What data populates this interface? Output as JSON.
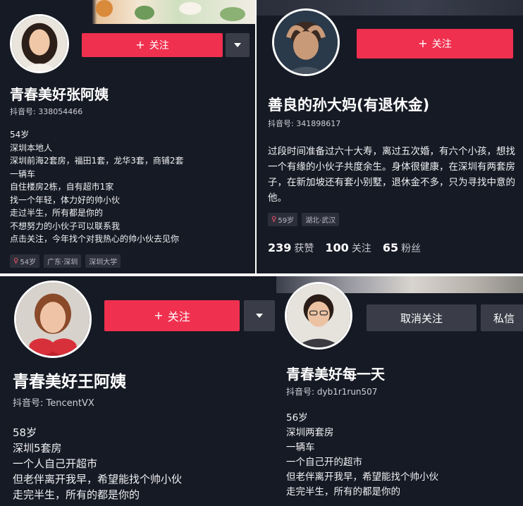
{
  "colors": {
    "background": "#161a24",
    "accent": "#f0304f",
    "secondary_button": "#3a3d47",
    "tag_bg": "#2c2f3a"
  },
  "profiles": [
    {
      "follow_label": "关注",
      "follow_icon": "plus-icon",
      "name": "青春美好张阿姨",
      "douyin_id": "抖音号: 338054466",
      "bio": [
        "54岁",
        "深圳本地人",
        "深圳前海2套房，福田1套，龙华3套，商铺2套",
        "一辆车",
        "自住楼房2栋，自有超市1家",
        "找一个年轻，体力好的帅小伙",
        "走过半生，所有都是你的",
        "不想努力的小伙子可以联系我",
        "点击关注，今年找个对我热心的帅小伙去见你"
      ],
      "tags": [
        "54岁",
        "广东·深圳",
        "深圳大学"
      ]
    },
    {
      "follow_label": "关注",
      "follow_icon": "plus-icon",
      "name": "善良的孙大妈(有退休金)",
      "douyin_id": "抖音号: 341898617",
      "bio_paragraph": "过段时间准备过六十大寿，离过五次婚，有六个小孩，想找一个有缘的小伙子共度余生。身体很健康，在深圳有两套房子，在新加坡还有套小别墅，退休金不多，只为寻找中意的他。",
      "tags": [
        "59岁",
        "湖北·武汉"
      ],
      "stats": [
        {
          "value": "239",
          "label": "获赞"
        },
        {
          "value": "100",
          "label": "关注"
        },
        {
          "value": "65",
          "label": "粉丝"
        }
      ]
    },
    {
      "follow_label": "关注",
      "follow_icon": "plus-icon",
      "name": "青春美好王阿姨",
      "douyin_id": "抖音号: TencentVX",
      "bio": [
        "58岁",
        "深圳5套房",
        "一个人自己开超市",
        "但老伴离开我早，希望能找个帅小伙",
        "走完半生，所有的都是你的"
      ]
    },
    {
      "unfollow_label": "取消关注",
      "message_label": "私信",
      "name": "青春美好每一天",
      "douyin_id": "抖音号: dyb1r1run507",
      "bio": [
        "56岁",
        "深圳两套房",
        "一辆车",
        "一个自己开的超市",
        "但老伴离开我早，希望能找个帅小伙",
        "走完半生，所有的都是你的"
      ]
    }
  ]
}
